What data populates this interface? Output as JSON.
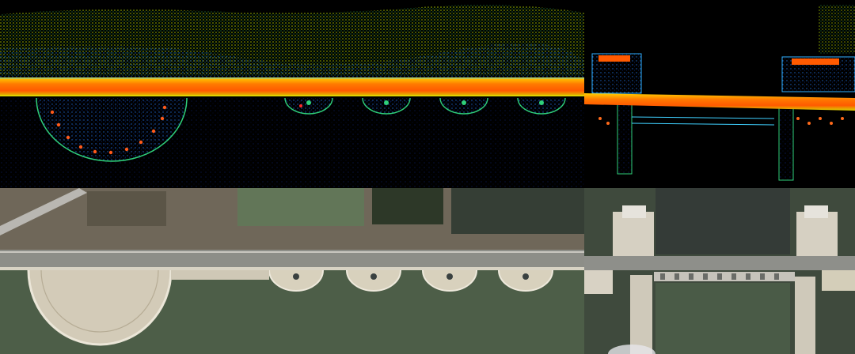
{
  "colors": {
    "lidar_background": "#000000",
    "lidar_high": "#ff6a00",
    "lidar_mid": "#c8e600",
    "lidar_low": "#1f7ad6",
    "lidar_deep": "#0a1e6a",
    "sat_water": "#4d5e48",
    "sat_road": "#8d8e88",
    "sat_plaza": "#d3cbb8",
    "sat_land": "#6f6759"
  },
  "panels": [
    {
      "name": "lidar-point-cloud-dam-overview",
      "kind": "point-cloud"
    },
    {
      "name": "lidar-point-cloud-sluice-gate",
      "kind": "point-cloud"
    },
    {
      "name": "satellite-image-dam-overview",
      "kind": "satellite-image"
    },
    {
      "name": "satellite-image-sluice-gate",
      "kind": "satellite-image"
    }
  ]
}
